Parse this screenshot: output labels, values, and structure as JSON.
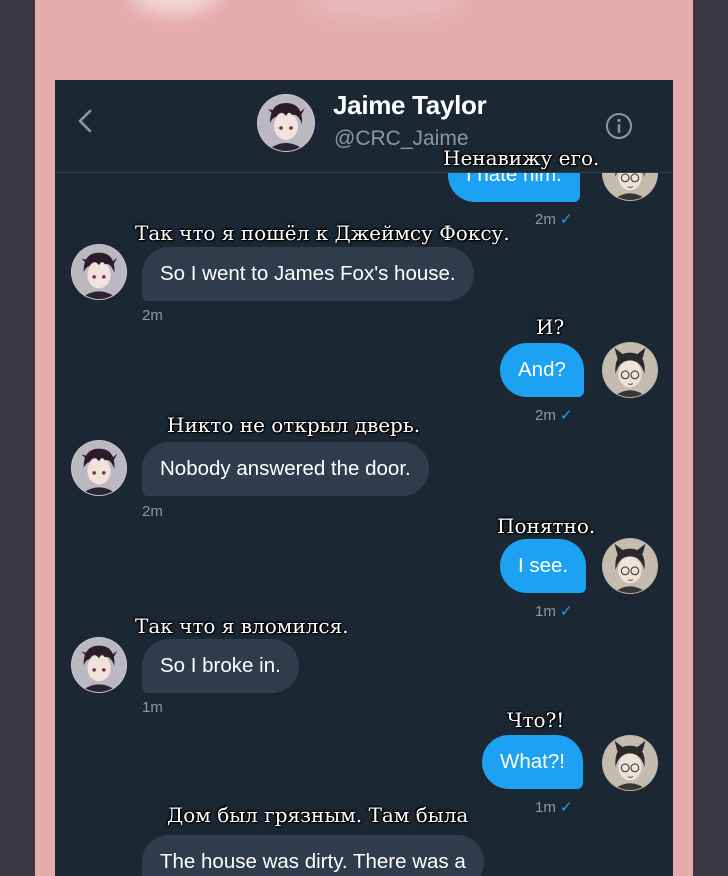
{
  "header": {
    "name": "Jaime Taylor",
    "handle": "@CRC_Jaime",
    "back_icon": "chevron-left-icon",
    "info_icon": "info-icon"
  },
  "messages": [
    {
      "side": "out",
      "text": "I hate him.",
      "time": "2m",
      "seen": "✓",
      "translation": "Ненавижу его."
    },
    {
      "side": "in",
      "text": "So I went to James Fox's house.",
      "time": "2m",
      "translation": "Так что я пошёл к Джеймсу Фоксу."
    },
    {
      "side": "out",
      "text": "And?",
      "time": "2m",
      "seen": "✓",
      "translation": "И?"
    },
    {
      "side": "in",
      "text": "Nobody answered the door.",
      "time": "2m",
      "translation": "Никто не открыл дверь."
    },
    {
      "side": "out",
      "text": "I see.",
      "time": "1m",
      "seen": "✓",
      "translation": "Понятно."
    },
    {
      "side": "in",
      "text": "So I broke in.",
      "time": "1m",
      "translation": "Так что я вломился."
    },
    {
      "side": "out",
      "text": "What?!",
      "time": "1m",
      "seen": "✓",
      "translation": "Что?!"
    },
    {
      "side": "in",
      "text": "The house was dirty. There was a",
      "translation": "Дом был грязным. Там была"
    }
  ],
  "colors": {
    "background": "#1c2734",
    "incoming_bubble": "#2f3c4b",
    "outgoing_bubble": "#1da1f2",
    "meta_text": "#8899a6",
    "frame": "#e5acab"
  }
}
